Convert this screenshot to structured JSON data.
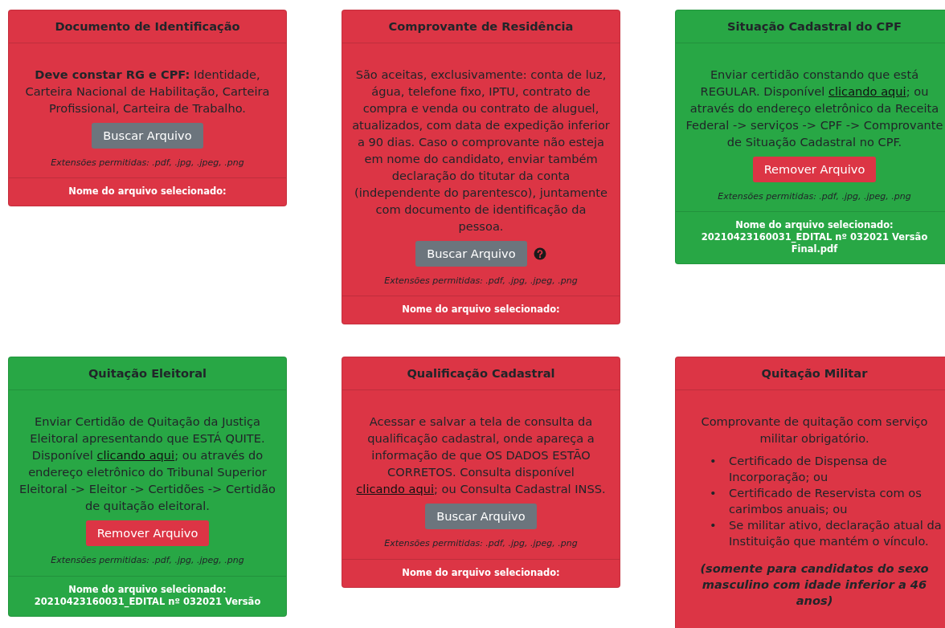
{
  "cards": [
    {
      "title": "Documento de Identificação",
      "color": "#dc3545",
      "description": [
        {
          "kind": "text",
          "text": "**Deve constar RG e CPF:** Identidade, Carteira Nacional de Habilitação, Carteira Profissional, Carteira de Trabalho."
        }
      ],
      "button": {
        "kind": "browse",
        "label": "Buscar Arquivo"
      },
      "help": false,
      "extensions": "Extensões permitidas: .pdf, .jpg, .jpeg, .png",
      "file_label": "Nome do arquivo selecionado:"
    },
    {
      "title": "Comprovante de Residência",
      "color": "#dc3545",
      "description": [
        {
          "kind": "text",
          "text": "São aceitas, exclusivamente: conta de luz, água, telefone fixo, IPTU, contrato de compra e venda ou contrato de aluguel, atualizados, com data de expedição inferior a 90 dias. Caso o comprovante não esteja em nome do candidato, enviar também declaração do titutar da conta (independente do parentesco), juntamente com documento de identificação da pessoa."
        }
      ],
      "button": {
        "kind": "browse",
        "label": "Buscar Arquivo"
      },
      "help": true,
      "extensions": "Extensões permitidas: .pdf, .jpg, .jpeg, .png",
      "file_label": "Nome do arquivo selecionado:"
    },
    {
      "title": "Situação Cadastral do CPF",
      "color": "#28a745",
      "description": [
        {
          "kind": "text",
          "text": "Enviar certidão constando que está REGULAR. Disponível "
        },
        {
          "kind": "link",
          "text": "clicando aqui"
        },
        {
          "kind": "text",
          "text": "; ou através do endereço eletrônico da Receita Federal -> serviços -> CPF -> Comprovante de Situação Cadastral no CPF."
        }
      ],
      "button": {
        "kind": "remove",
        "label": "Remover Arquivo"
      },
      "help": false,
      "extensions": "Extensões permitidas: .pdf, .jpg, .jpeg, .png",
      "file_label": "Nome do arquivo selecionado:",
      "file_name": "20210423160031_EDITAL nº 032021 Versão Final.pdf"
    },
    {
      "title": "Quitação Eleitoral",
      "color": "#28a745",
      "description": [
        {
          "kind": "text",
          "text": "Enviar Certidão de Quitação da Justiça Eleitoral apresentando que ESTÁ QUITE. Disponível "
        },
        {
          "kind": "link",
          "text": "clicando aqui"
        },
        {
          "kind": "text",
          "text": "; ou através do endereço eletrônico do Tribunal Superior Eleitoral -> Eleitor -> Certidões -> Certidão de quitação eleitoral."
        }
      ],
      "button": {
        "kind": "remove",
        "label": "Remover Arquivo"
      },
      "help": false,
      "extensions": "Extensões permitidas: .pdf, .jpg, .jpeg, .png",
      "file_label": "Nome do arquivo selecionado:",
      "file_name": "20210423160031_EDITAL nº 032021 Versão"
    },
    {
      "title": "Qualificação Cadastral",
      "color": "#dc3545",
      "description": [
        {
          "kind": "text",
          "text": "Acessar e salvar a tela de consulta da qualificação cadastral, onde apareça a informação de que OS DADOS ESTÃO CORRETOS. Consulta disponível "
        },
        {
          "kind": "link",
          "text": "clicando aqui"
        },
        {
          "kind": "text",
          "text": "; ou Consulta Cadastral INSS."
        }
      ],
      "button": {
        "kind": "browse",
        "label": "Buscar Arquivo"
      },
      "help": false,
      "extensions": "Extensões permitidas: .pdf, .jpg, .jpeg, .png",
      "file_label": "Nome do arquivo selecionado:"
    },
    {
      "title": "Quitação Militar",
      "color": "#dc3545",
      "description": [
        {
          "kind": "text",
          "text": "Comprovante de quitação com serviço militar obrigatório."
        }
      ],
      "items": [
        {
          "bullet": "•",
          "text": "Certificado de Dispensa de Incorporação; ou"
        },
        {
          "bullet": "•",
          "text": "Certificado de Reservista com os carimbos anuais; ou"
        },
        {
          "bullet": "•",
          "text": "Se militar ativo, declaração atual da Instituição que mantém o vínculo."
        }
      ],
      "note": "(somente para candidatos do sexo masculino com idade inferior a 46 anos)"
    }
  ]
}
